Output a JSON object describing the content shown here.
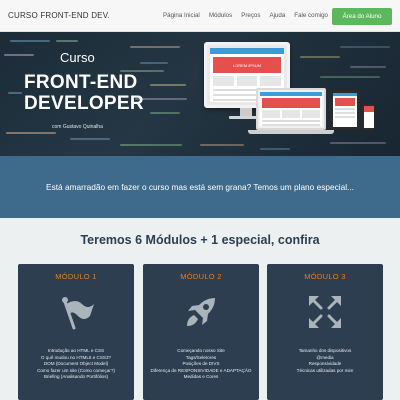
{
  "nav": {
    "brand": "CURSO FRONT-END DEV.",
    "links": [
      "Página Inicial",
      "Módulos",
      "Preços",
      "Ajuda",
      "Fale comigo"
    ],
    "cta": "Área do Aluno"
  },
  "hero": {
    "kicker": "Curso",
    "title_line1": "FRONT-END",
    "title_line2": "DEVELOPER",
    "author": "com Gustavo Quinalha",
    "mock_banner": "LOREM IPSUM"
  },
  "band": {
    "text": "Está amarradão em fazer o curso mas está sem grana? Temos um plano especial..."
  },
  "modules": {
    "heading": "Teremos 6 Módulos + 1 especial, confira",
    "cards": [
      {
        "title": "MÓDULO 1",
        "icon": "flag-icon",
        "items": [
          "Introdução ao HTML e CSS",
          "O quê mudou no HTML5 e CSS3?",
          "DOM (Document Object Model)",
          "Como fazer um site (Como começar?)",
          "Briefing (Analisando Portifólios)"
        ]
      },
      {
        "title": "MÓDULO 2",
        "icon": "rocket-icon",
        "items": [
          "Começando nosso Site",
          "Tags/Seletores",
          "Posições de DIVS",
          "Diferença de RESPONSIVIDADE e ADAPTAÇÃO",
          "Medidas e Cores"
        ]
      },
      {
        "title": "MÓDULO 3",
        "icon": "expand-arrows-icon",
        "items": [
          "Tamanho dos dispositivos",
          "@media",
          "Responsividade",
          "Técnicas utilizadas por mim"
        ]
      }
    ]
  },
  "colors": {
    "accent_green": "#5cb85c",
    "band_blue": "#3e6a8b",
    "card_bg": "#2c3e50",
    "module_orange": "#e67e22",
    "hero_dark": "#1d2d3a"
  }
}
